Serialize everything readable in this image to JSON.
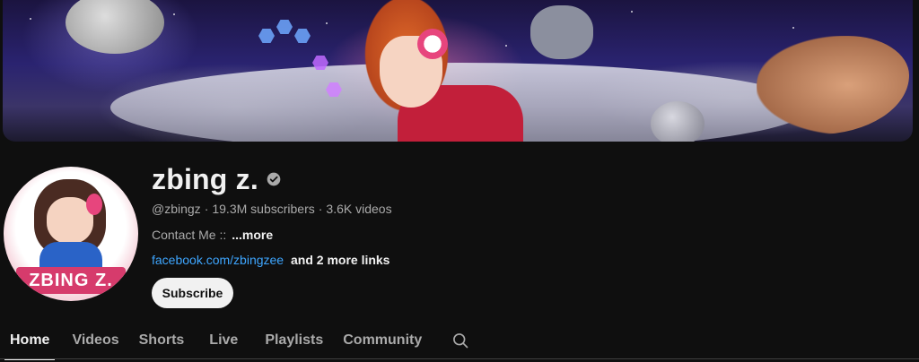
{
  "channel": {
    "name": "zbing z.",
    "handle": "@zbingz",
    "subscribers": "19.3M subscribers",
    "videos": "3.6K videos",
    "separator": "·",
    "description": "Contact Me ::",
    "more_label": "...more",
    "link": "facebook.com/zbingzee",
    "more_links": "and 2 more links",
    "avatar_text": "ZBING Z."
  },
  "subscribe_label": "Subscribe",
  "tabs": [
    {
      "label": "Home",
      "active": true
    },
    {
      "label": "Videos",
      "active": false
    },
    {
      "label": "Shorts",
      "active": false
    },
    {
      "label": "Live",
      "active": false
    },
    {
      "label": "Playlists",
      "active": false
    },
    {
      "label": "Community",
      "active": false
    }
  ],
  "icons": {
    "verified": "verified-check-icon",
    "search": "search-icon"
  },
  "colors": {
    "background": "#0f0f0f",
    "text_primary": "#f1f1f1",
    "text_secondary": "#aaaaaa",
    "link": "#3ea6ff",
    "button_bg": "#f1f1f1"
  }
}
